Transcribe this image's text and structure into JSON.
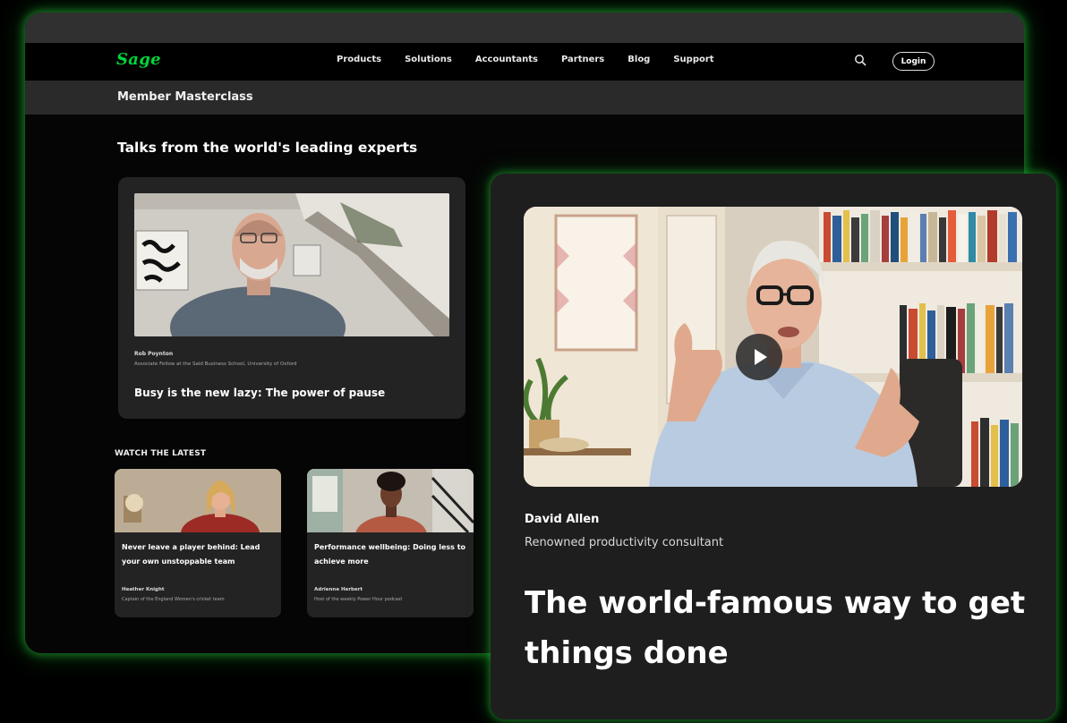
{
  "nav": {
    "logo": "Sage",
    "links": [
      "Products",
      "Solutions",
      "Accountants",
      "Partners",
      "Blog",
      "Support"
    ],
    "login_label": "Login"
  },
  "sub_header": {
    "title": "Member Masterclass"
  },
  "main": {
    "section_heading": "Talks from the world's leading experts",
    "feature": {
      "speaker": "Rob Poynton",
      "role": "Associate Fellow at the Saïd Business School, University of Oxford",
      "title": "Busy is the new lazy: The power of pause"
    },
    "latest_heading": "WATCH THE LATEST",
    "latest": [
      {
        "title": "Never leave a player behind: Lead your own unstoppable team",
        "speaker": "Heather Knight",
        "role": "Captain of the England Women's cricket team"
      },
      {
        "title": "Performance wellbeing: Doing less to achieve more",
        "speaker": "Adrienne Herbert",
        "role": "Host of the weekly Power Hour podcast"
      }
    ]
  },
  "featured_video": {
    "speaker": "David Allen",
    "role": "Renowned productivity consultant",
    "title": "The world-famous way to get things done"
  },
  "colors": {
    "brand_green": "#00d639",
    "glow_green": "#28c83c",
    "card_bg": "#1e1e1e"
  },
  "icons": [
    "search-icon",
    "play-icon"
  ]
}
